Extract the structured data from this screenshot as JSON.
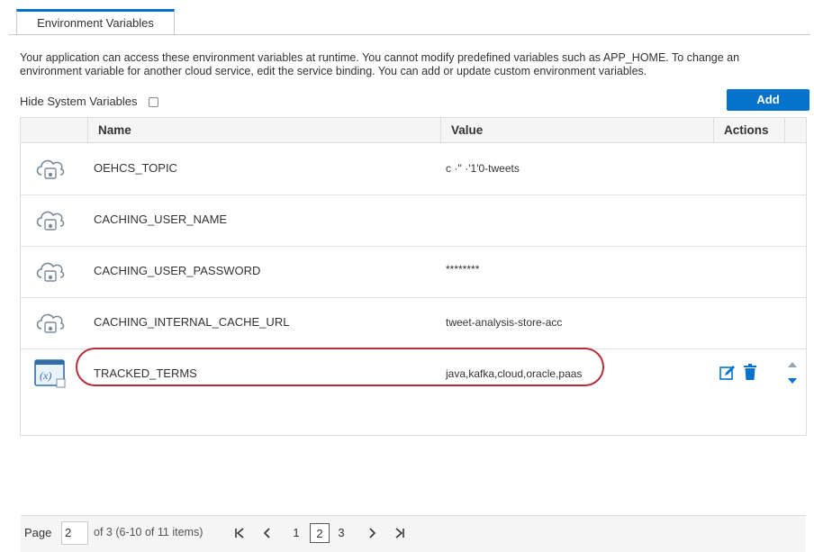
{
  "tab": {
    "label": "Environment Variables"
  },
  "description": "Your application can access these environment variables at runtime. You cannot modify predefined variables such as APP_HOME. To change an environment variable for another cloud service, edit the service binding. You can add or update custom environment variables.",
  "filter": {
    "hide_system_label": "Hide System Variables",
    "checked": false
  },
  "add_button": {
    "label": "Add"
  },
  "table": {
    "headers": {
      "name": "Name",
      "value": "Value",
      "actions": "Actions"
    },
    "rows": [
      {
        "name": "OEHCS_TOPIC",
        "value": "c   ·'' ·'1'0-tweets",
        "icon": "cloud-service-icon"
      },
      {
        "name": "CACHING_USER_NAME",
        "value": "",
        "icon": "cloud-service-icon"
      },
      {
        "name": "CACHING_USER_PASSWORD",
        "value": "********",
        "icon": "cloud-service-icon"
      },
      {
        "name": "CACHING_INTERNAL_CACHE_URL",
        "value": "tweet-analysis-store-acc",
        "icon": "cloud-service-icon"
      },
      {
        "name": "TRACKED_TERMS",
        "value": "java,kafka,cloud,oracle,paas",
        "icon": "custom-variable-icon"
      }
    ]
  },
  "pagination": {
    "page_label": "Page",
    "page_value": "2",
    "of_text": "of 3 (6-10 of 11 items)",
    "pages": [
      "1",
      "2",
      "3"
    ],
    "current_page": "2",
    "first_icon": "first-page-icon",
    "prev_icon": "previous-page-icon",
    "next_icon": "next-page-icon",
    "last_icon": "last-page-icon"
  },
  "colors": {
    "accent": "#0572ce",
    "highlight": "#b52f3a"
  }
}
